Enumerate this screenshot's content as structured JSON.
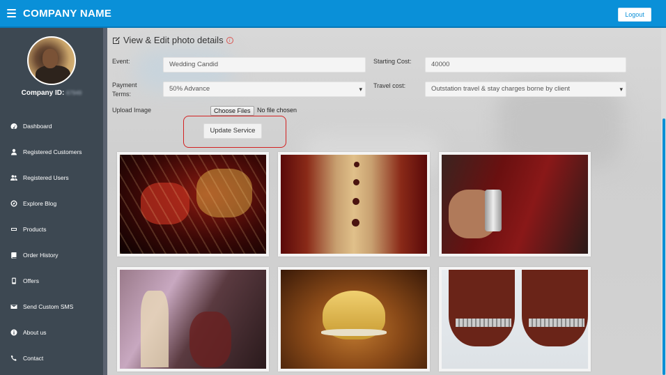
{
  "header": {
    "brand": "COMPANY NAME",
    "logout_label": "Logout",
    "bg_color": "#0a90d8"
  },
  "sidebar": {
    "company_id_label": "Company ID:",
    "company_id_value": "67949",
    "items": [
      {
        "label": "Dashboard",
        "icon": "dashboard-icon"
      },
      {
        "label": "Registered Customers",
        "icon": "user-icon"
      },
      {
        "label": "Registered Users",
        "icon": "users-icon"
      },
      {
        "label": "Explore Blog",
        "icon": "compass-icon"
      },
      {
        "label": "Products",
        "icon": "product-icon"
      },
      {
        "label": "Order History",
        "icon": "book-icon"
      },
      {
        "label": "Offers",
        "icon": "mobile-icon"
      },
      {
        "label": "Send Custom SMS",
        "icon": "envelope-icon"
      },
      {
        "label": "About us",
        "icon": "info-icon"
      },
      {
        "label": "Contact",
        "icon": "phone-icon"
      }
    ]
  },
  "form": {
    "title": "View & Edit photo details",
    "event_label": "Event:",
    "event_value": "Wedding Candid",
    "starting_cost_label": "Starting Cost:",
    "starting_cost_value": "40000",
    "payment_terms_label": "Payment Terms:",
    "payment_terms_value": "50% Advance",
    "travel_cost_label": "Travel cost:",
    "travel_cost_value": "Outstation travel & stay charges borne by client",
    "upload_label": "Upload Image",
    "choose_files_label": "Choose Files",
    "no_file_text": "No file chosen",
    "update_button_label": "Update Service",
    "highlight_color": "#d32020"
  },
  "gallery": {
    "photos": [
      "wedding-couple-photo",
      "sherwani-buttons-photo",
      "groom-watch-photo",
      "baraat-procession-photo",
      "turban-photo",
      "bride-anklets-photo"
    ]
  }
}
